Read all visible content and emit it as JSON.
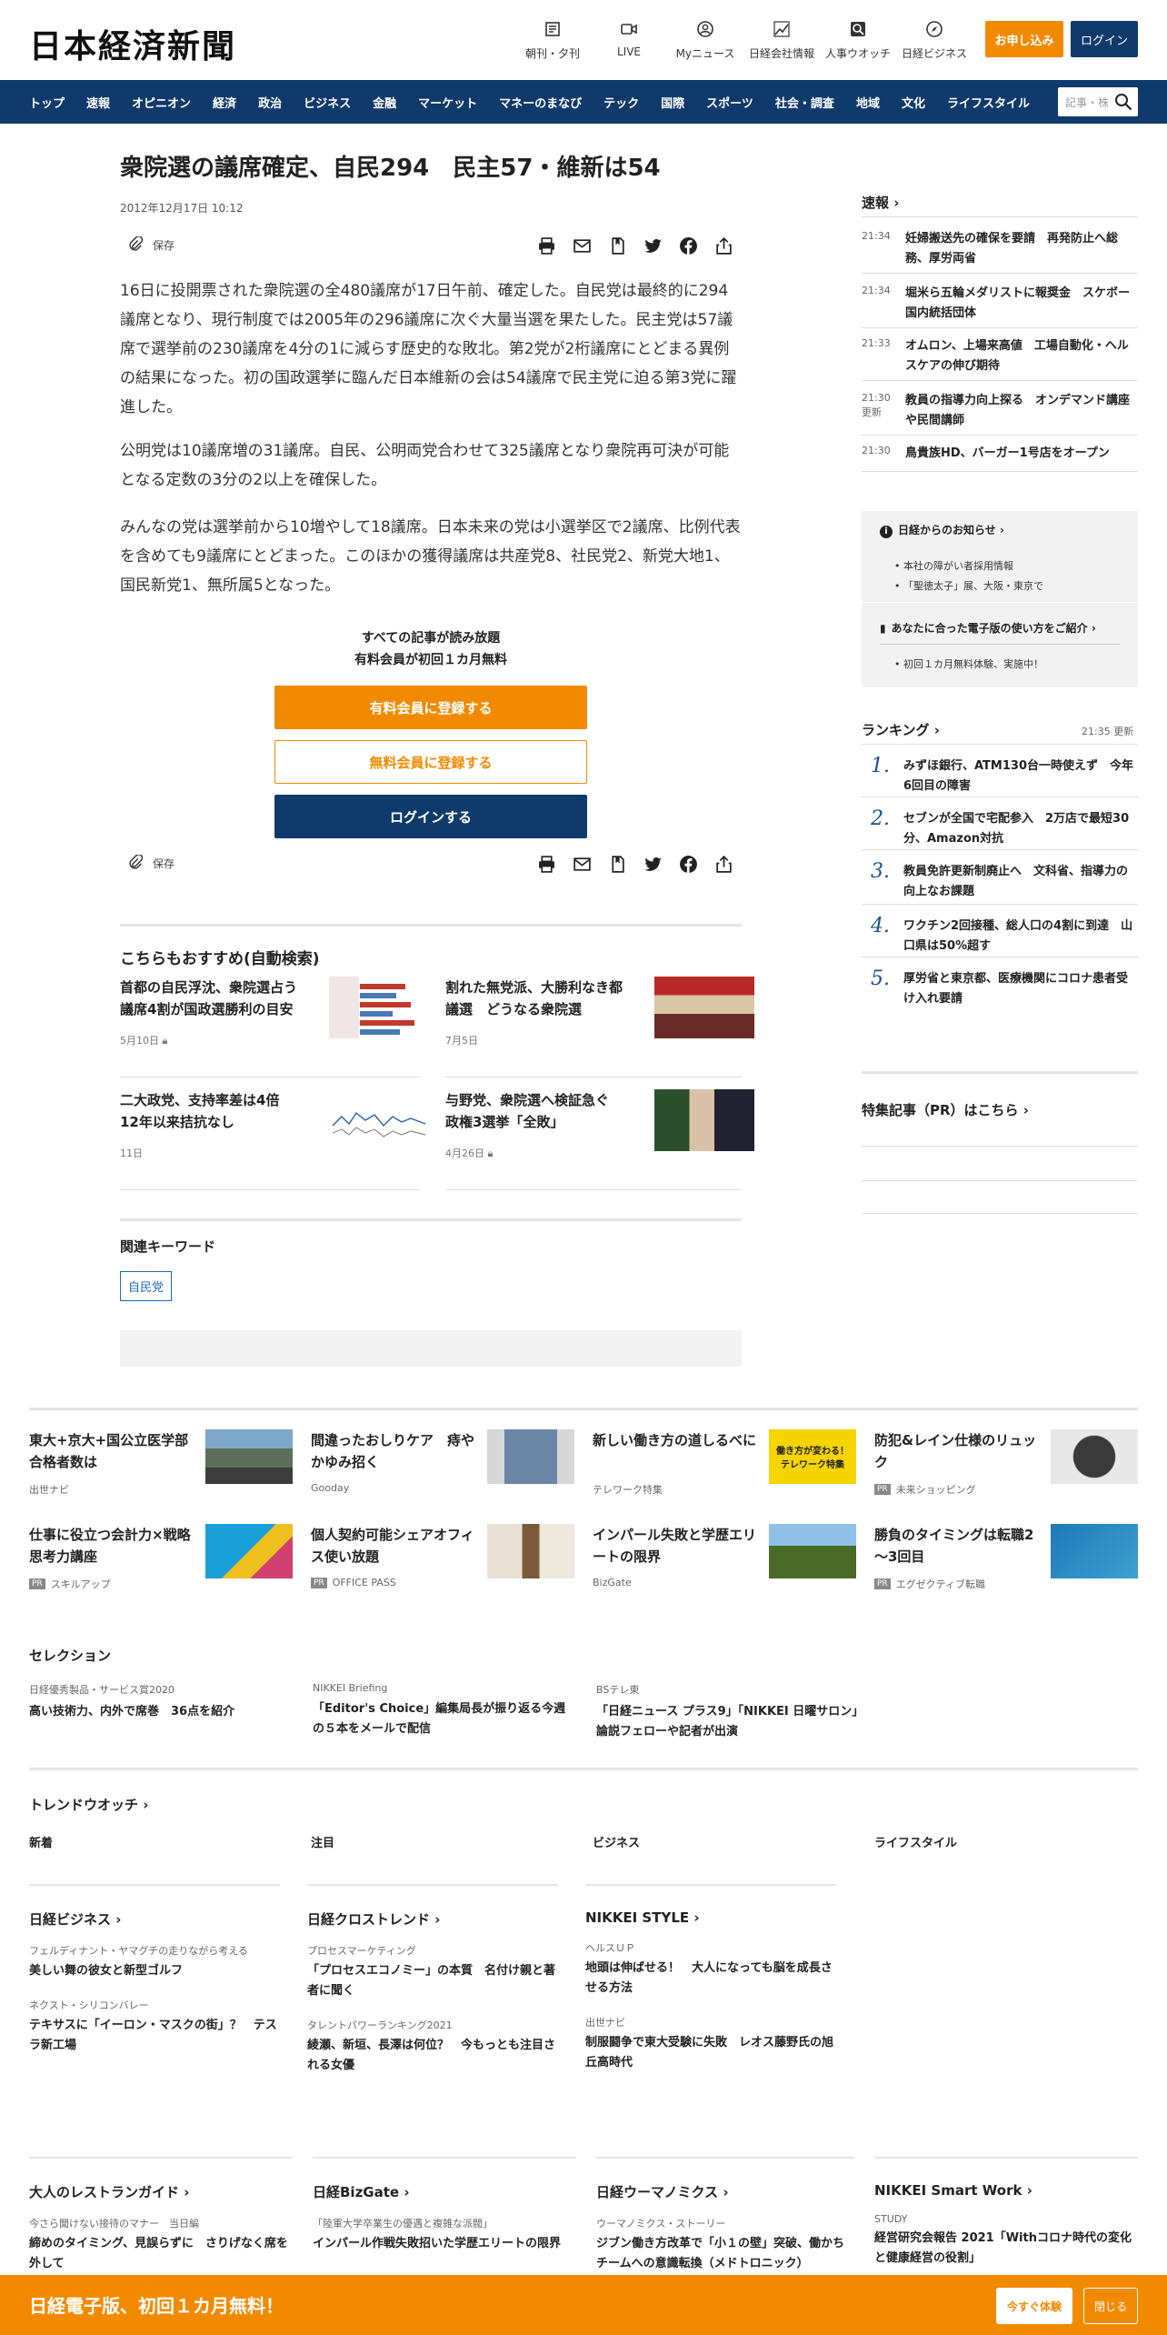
{
  "header": {
    "logo": "日本経済新聞",
    "icons": [
      {
        "label": "朝刊・夕刊",
        "icon": "newspaper-icon"
      },
      {
        "label": "LIVE",
        "icon": "video-icon"
      },
      {
        "label": "Myニュース",
        "icon": "user-icon"
      },
      {
        "label": "日経会社情報",
        "icon": "chart-icon"
      },
      {
        "label": "人事ウオッチ",
        "icon": "search-person-icon"
      },
      {
        "label": "日経ビジネス",
        "icon": "compass-icon"
      }
    ],
    "apply_label": "お申し込み",
    "login_label": "ログイン"
  },
  "nav": {
    "items": [
      "トップ",
      "速報",
      "オピニオン",
      "経済",
      "政治",
      "ビジネス",
      "金融",
      "マーケット",
      "マネーのまなび",
      "テック",
      "国際",
      "スポーツ",
      "社会・調査",
      "地域",
      "文化",
      "ライフスタイル"
    ],
    "search_placeholder": "記事・株"
  },
  "article": {
    "title": "衆院選の議席確定、自民294　民主57・維新は54",
    "date": "2012年12月17日 10:12",
    "save_label": "保存",
    "paragraphs": [
      "16日に投開票された衆院選の全480議席が17日午前、確定した。自民党は最終的に294議席となり、現行制度では2005年の296議席に次ぐ大量当選を果たした。民主党は57議席で選挙前の230議席を4分の1に減らす歴史的な敗北。第2党が2桁議席にとどまる異例の結果になった。初の国政選挙に臨んだ日本維新の会は54議席で民主党に迫る第3党に躍進した。",
      "公明党は10議席増の31議席。自民、公明両党合わせて325議席となり衆院再可決が可能となる定数の3分の2以上を確保した。",
      "みんなの党は選挙前から10増やして18議席。日本未来の党は小選挙区で2議席、比例代表を含めても9議席にとどまった。このほかの獲得議席は共産党8、社民党2、新党大地1、国民新党1、無所属5となった。"
    ]
  },
  "paywall": {
    "line1": "すべての記事が読み放題",
    "line2": "有料会員が初回１カ月無料",
    "paid_label": "有料会員に登録する",
    "free_label": "無料会員に登録する",
    "login_label": "ログインする"
  },
  "recommend": {
    "title": "こちらもおすすめ(自動検索)",
    "items": [
      {
        "title": "首都の自民浮沈、衆院選占う　議席4割が国政選勝利の目安",
        "date": "5月10日"
      },
      {
        "title": "割れた無党派、大勝利なき都議選　どうなる衆院選",
        "date": "7月5日"
      },
      {
        "title": "二大政党、支持率差は4倍　12年以来拮抗なし",
        "date": "11日"
      },
      {
        "title": "与野党、衆院選へ検証急ぐ　政権3選挙「全敗」",
        "date": "4月26日"
      }
    ]
  },
  "keywords": {
    "title": "関連キーワード",
    "tags": [
      "自民党"
    ]
  },
  "sidebar": {
    "flash_title": "速報",
    "flash": [
      {
        "time": "21:34",
        "text": "妊婦搬送先の確保を要請　再発防止へ総務、厚労両省"
      },
      {
        "time": "21:34",
        "text": "堀米ら五輪メダリストに報奨金　スケボー国内統括団体"
      },
      {
        "time": "21:33",
        "text": "オムロン、上場来高値　工場自動化・ヘルスケアの伸び期待"
      },
      {
        "time": "21:30",
        "sub": "更新",
        "text": "教員の指導力向上探る　オンデマンド講座や民間講師"
      },
      {
        "time": "21:30",
        "text": "鳥貴族HD、バーガー1号店をオープン"
      }
    ],
    "notice_title": "日経からのお知らせ",
    "notices": [
      "本社の障がい者採用情報",
      "「聖徳太子」展、大阪・東京で"
    ],
    "guide_title": "あなたに合った電子版の使い方をご紹介",
    "guides": [
      "初回１カ月無料体験、実施中！"
    ],
    "ranking_title": "ランキング",
    "ranking_time": "21:35",
    "ranking_updated": "更新",
    "ranking": [
      {
        "n": "1.",
        "text": "みずほ銀行、ATM130台一時使えず　今年6回目の障害"
      },
      {
        "n": "2.",
        "text": "セブンが全国で宅配参入　2万店で最短30分、Amazon対抗"
      },
      {
        "n": "3.",
        "text": "教員免許更新制廃止へ　文科省、指導力の向上なお課題"
      },
      {
        "n": "4.",
        "text": "ワクチン2回接種、総人口の4割に到達　山口県は50%超す"
      },
      {
        "n": "5.",
        "text": "厚労省と東京都、医療機関にコロナ患者受け入れ要請"
      }
    ],
    "special_title": "特集記事（PR）はこちら"
  },
  "ads": [
    {
      "title": "東大+京大+国公立医学部　合格者数は",
      "source": "出世ナビ",
      "pr": false
    },
    {
      "title": "間違ったおしりケア　痔やかゆみ招く",
      "source": "Gooday",
      "pr": false
    },
    {
      "title": "新しい働き方の道しるべに",
      "source": "テレワーク特集",
      "pr": false
    },
    {
      "title": "防犯&レイン仕様のリュック",
      "source": "未来ショッピング",
      "pr": true
    },
    {
      "title": "仕事に役立つ会計力×戦略思考力講座",
      "source": "スキルアップ",
      "pr": true
    },
    {
      "title": "個人契約可能シェアオフィス使い放題",
      "source": "OFFICE PASS",
      "pr": true
    },
    {
      "title": "インパール失敗と学歴エリートの限界",
      "source": "BizGate",
      "pr": false
    },
    {
      "title": "勝負のタイミングは転職2～3回目",
      "source": "エグゼクティブ転職",
      "pr": true
    }
  ],
  "ad_image_text": "働き方が変わる！ テレワーク特集",
  "pr_label": "PR",
  "selection": {
    "title": "セレクション",
    "items": [
      {
        "kicker": "日経優秀製品・サービス賞2020",
        "title": "高い技術力、内外で席巻　36点を紹介"
      },
      {
        "kicker": "NIKKEI Briefing",
        "title": "「Editor's Choice」編集局長が振り返る今週の５本をメールで配信"
      },
      {
        "kicker": "BSテレ東",
        "title": "「日経ニュース プラス9」「NIKKEI 日曜サロン」論説フェローや記者が出演"
      }
    ]
  },
  "trend": {
    "title": "トレンドウオッチ",
    "tabs": [
      "新着",
      "注目",
      "ビジネス",
      "ライフスタイル"
    ],
    "columns": [
      {
        "title": "日経ビジネス",
        "items": [
          {
            "kicker": "フェルディナント・ヤマグチの走りながら考える",
            "title": "美しい舞の彼女と新型ゴルフ"
          },
          {
            "kicker": "ネクスト・シリコンバレー",
            "title": "テキサスに「イーロン・マスクの街」？　テスラ新工場"
          }
        ]
      },
      {
        "title": "日経クロストレンド",
        "items": [
          {
            "kicker": "プロセスマーケティング",
            "title": "「プロセスエコノミー」の本質　名付け親と著者に聞く"
          },
          {
            "kicker": "タレントパワーランキング2021",
            "title": "綾瀬、新垣、長澤は何位？　今もっとも注目される女優"
          }
        ]
      },
      {
        "title": "NIKKEI STYLE",
        "items": [
          {
            "kicker": "ヘルスＵＰ",
            "title": "地頭は伸ばせる！　大人になっても脳を成長させる方法"
          },
          {
            "kicker": "出世ナビ",
            "title": "制服闘争で東大受験に失敗　レオス藤野氏の旭丘高時代"
          }
        ]
      }
    ]
  },
  "bottom_cols": [
    {
      "title": "大人のレストランガイド",
      "kicker": "今さら聞けない接待のマナー　当日編",
      "text": "締めのタイミング、見誤らずに　さりげなく席を外して"
    },
    {
      "title": "日経BizGate",
      "kicker": "「陸軍大学卒業生の優遇と複雑な派閥」",
      "text": "インパール作戦失敗招いた学歴エリートの限界"
    },
    {
      "title": "日経ウーマノミクス",
      "kicker": "ウーマノミクス・ストーリー",
      "text": "ジブン働き方改革で「小１の壁」突破、働かちチームへの意識転換（メドトロニック）"
    },
    {
      "title": "NIKKEI Smart Work",
      "kicker": "STUDY",
      "text": "経営研究会報告 2021「Withコロナ時代の変化と健康経営の役割」"
    }
  ],
  "banner": {
    "text": "日経電子版、初回１カ月無料！",
    "try_label": "今すぐ体験",
    "close_label": "閉じる"
  }
}
